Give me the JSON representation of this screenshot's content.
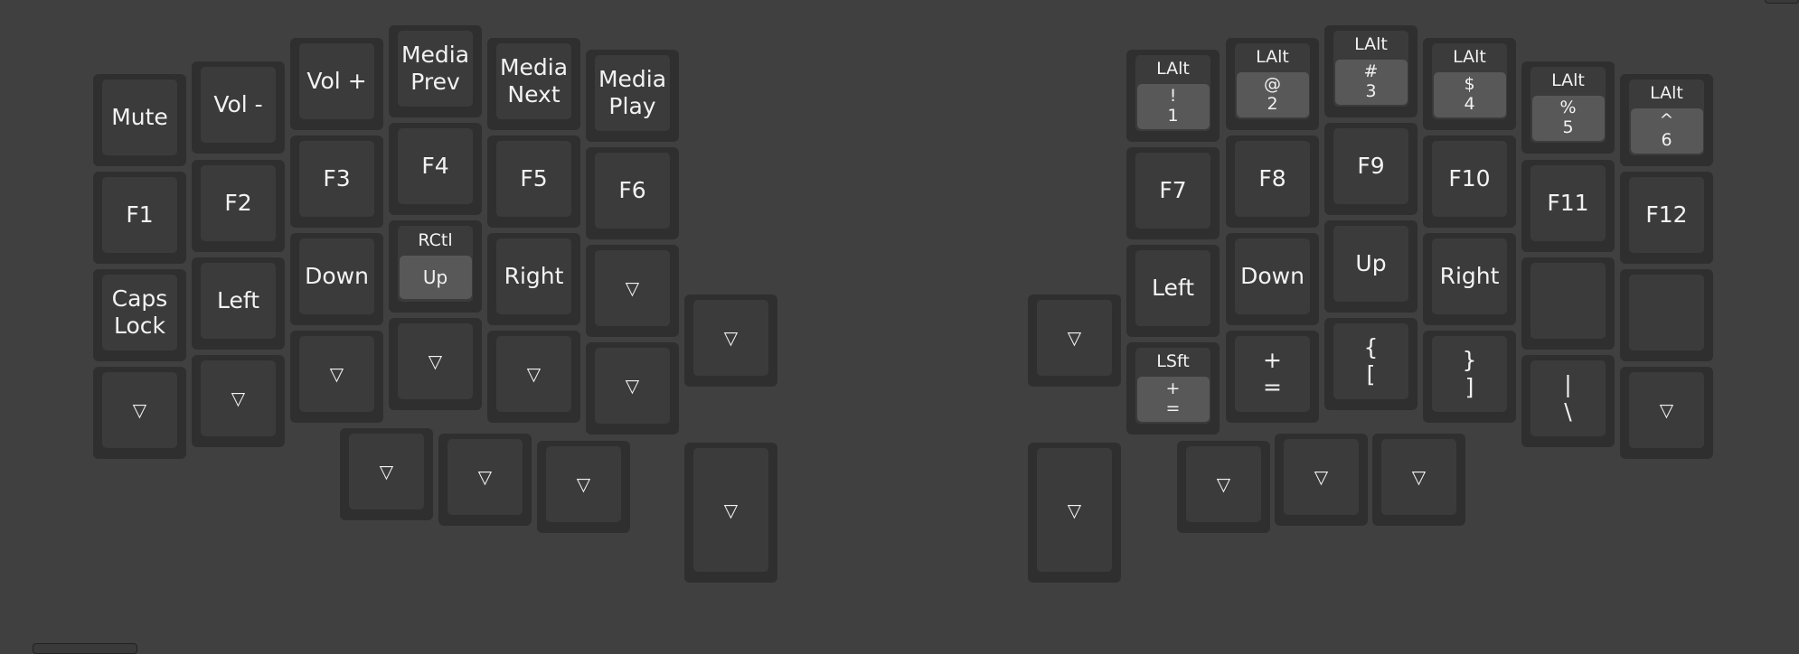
{
  "symbols": {
    "transparent": "▽"
  },
  "colors": {
    "background": "#404040",
    "key_base": "#2f2f2f",
    "key_cap": "#3b3b3b",
    "inner_label": "#585858",
    "text": "#f2f2f2"
  },
  "keys": [
    {
      "id": "l-mute",
      "label": "Mute"
    },
    {
      "id": "l-vol-down",
      "label": "Vol -"
    },
    {
      "id": "l-vol-up",
      "label": "Vol +"
    },
    {
      "id": "l-media-prev",
      "label": "Media\nPrev"
    },
    {
      "id": "l-media-next",
      "label": "Media\nNext"
    },
    {
      "id": "l-media-play",
      "label": "Media\nPlay"
    },
    {
      "id": "l-f1",
      "label": "F1"
    },
    {
      "id": "l-f2",
      "label": "F2"
    },
    {
      "id": "l-f3",
      "label": "F3"
    },
    {
      "id": "l-f4",
      "label": "F4"
    },
    {
      "id": "l-f5",
      "label": "F5"
    },
    {
      "id": "l-f6",
      "label": "F6"
    },
    {
      "id": "l-caps-lock",
      "label": "Caps\nLock"
    },
    {
      "id": "l-left",
      "label": "Left"
    },
    {
      "id": "l-down",
      "label": "Down"
    },
    {
      "id": "l-rctl-up",
      "mod": "RCtl",
      "inner": "Up",
      "big": true
    },
    {
      "id": "l-right",
      "label": "Right"
    },
    {
      "id": "l-trans-1",
      "trans": true
    },
    {
      "id": "l-trans-2",
      "trans": true
    },
    {
      "id": "l-trans-3",
      "trans": true
    },
    {
      "id": "l-trans-4",
      "trans": true
    },
    {
      "id": "l-trans-5",
      "trans": true
    },
    {
      "id": "l-trans-6",
      "trans": true
    },
    {
      "id": "l-trans-7",
      "trans": true
    },
    {
      "id": "l-trans-8",
      "trans": true
    },
    {
      "id": "l-trans-9",
      "trans": true
    },
    {
      "id": "l-trans-10",
      "trans": true
    },
    {
      "id": "l-trans-11",
      "trans": true
    },
    {
      "id": "l-trans-12",
      "trans": true
    },
    {
      "id": "r-lalt-1",
      "mod": "LAlt",
      "inner": "!\n1"
    },
    {
      "id": "r-lalt-2",
      "mod": "LAlt",
      "inner": "@\n2"
    },
    {
      "id": "r-lalt-3",
      "mod": "LAlt",
      "inner": "#\n3"
    },
    {
      "id": "r-lalt-4",
      "mod": "LAlt",
      "inner": "$\n4"
    },
    {
      "id": "r-lalt-5",
      "mod": "LAlt",
      "inner": "%\n5"
    },
    {
      "id": "r-lalt-6",
      "mod": "LAlt",
      "inner": "^\n6"
    },
    {
      "id": "r-f7",
      "label": "F7"
    },
    {
      "id": "r-f8",
      "label": "F8"
    },
    {
      "id": "r-f9",
      "label": "F9"
    },
    {
      "id": "r-f10",
      "label": "F10"
    },
    {
      "id": "r-f11",
      "label": "F11"
    },
    {
      "id": "r-f12",
      "label": "F12"
    },
    {
      "id": "r-left",
      "label": "Left"
    },
    {
      "id": "r-down",
      "label": "Down"
    },
    {
      "id": "r-up",
      "label": "Up"
    },
    {
      "id": "r-right",
      "label": "Right"
    },
    {
      "id": "r-blank-1",
      "label": ""
    },
    {
      "id": "r-blank-2",
      "label": ""
    },
    {
      "id": "r-trans-1",
      "trans": true
    },
    {
      "id": "r-lsft-equal",
      "mod": "LSft",
      "inner": "+\n="
    },
    {
      "id": "r-plus-equal",
      "label": "+\n="
    },
    {
      "id": "r-brace-open",
      "label": "{\n["
    },
    {
      "id": "r-brace-close",
      "label": "}\n]"
    },
    {
      "id": "r-pipe",
      "label": "|\n\\"
    },
    {
      "id": "r-trans-2",
      "trans": true
    },
    {
      "id": "r-trans-3",
      "trans": true
    },
    {
      "id": "r-trans-4",
      "trans": true
    },
    {
      "id": "r-trans-5",
      "trans": true
    },
    {
      "id": "r-trans-6",
      "trans": true
    }
  ]
}
